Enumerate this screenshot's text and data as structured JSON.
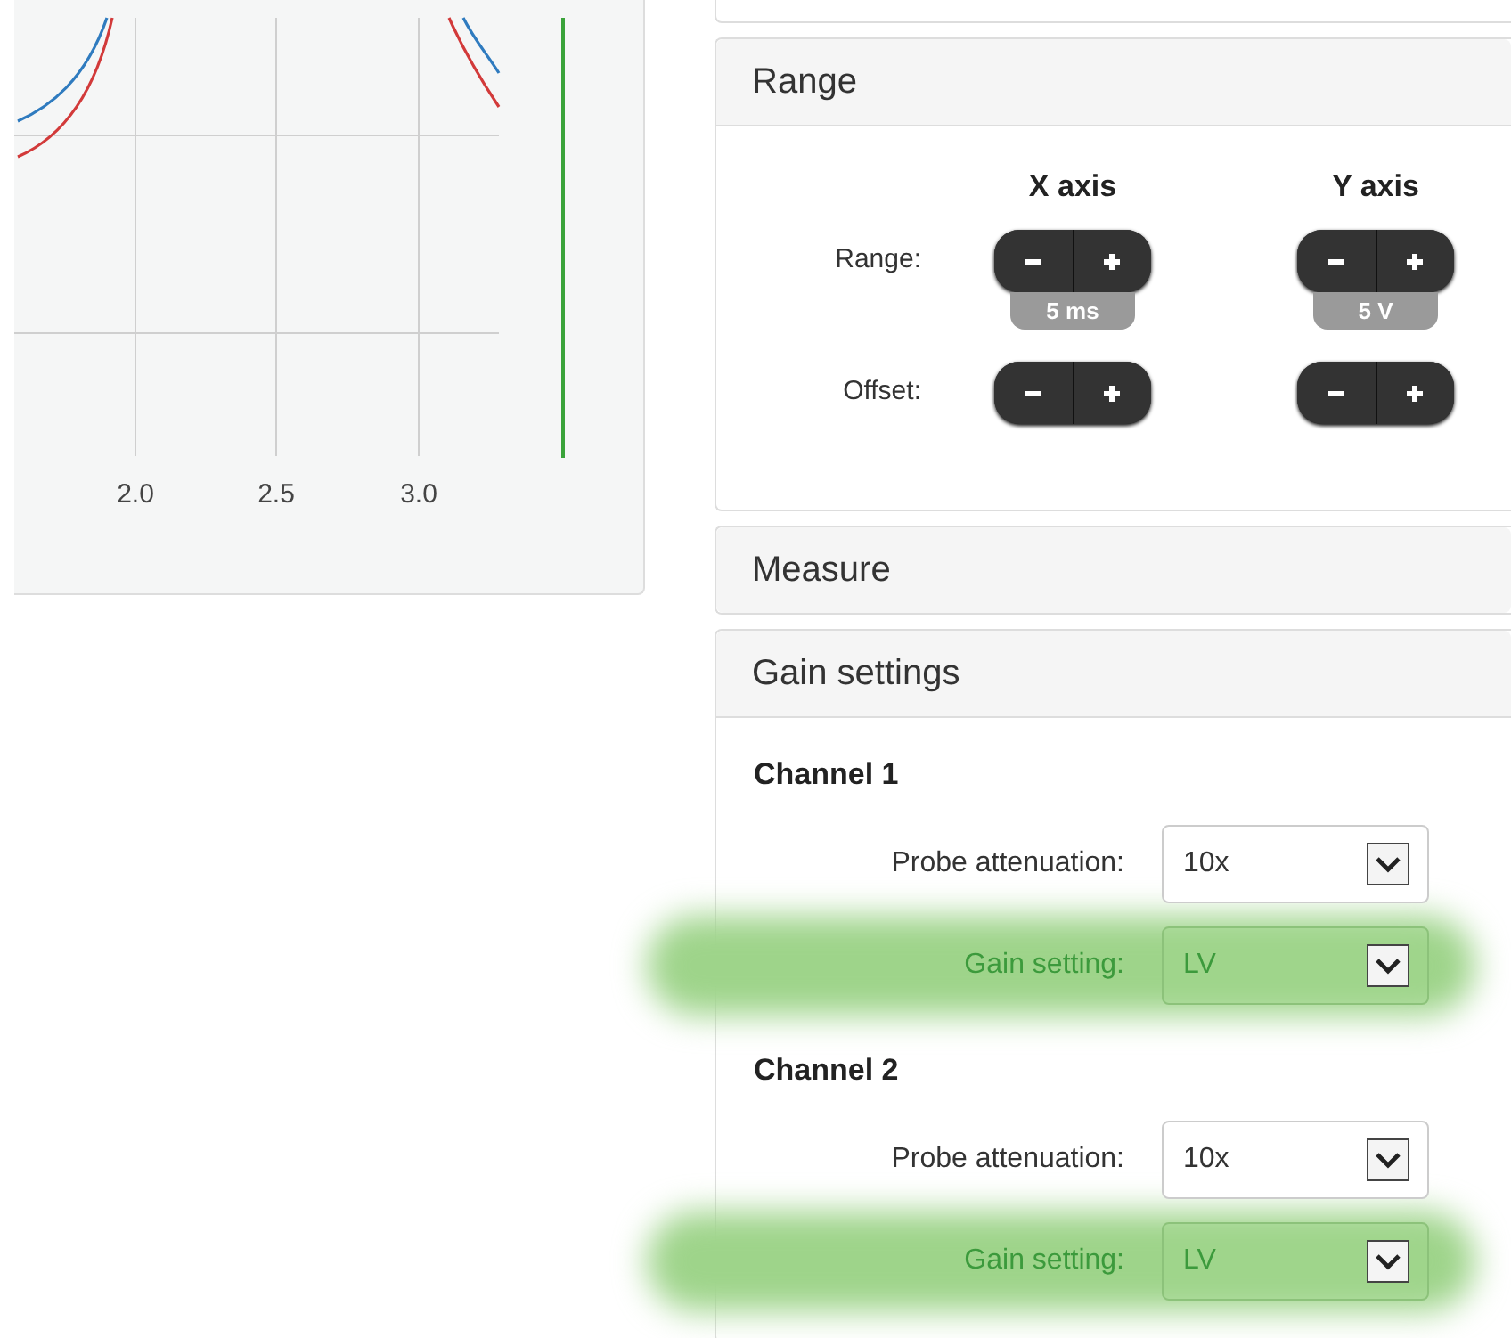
{
  "plot": {
    "x_tick_labels": [
      "2.0",
      "2.5",
      "3.0"
    ]
  },
  "panels": [
    {
      "kind": "range",
      "title": "Range",
      "expanded": true,
      "axes": [
        "X axis",
        "Y axis"
      ],
      "rows": [
        {
          "label": "Range:",
          "controls": [
            {
              "kind": "stepper",
              "readout": "5 ms"
            },
            {
              "kind": "stepper",
              "readout": "5 V"
            }
          ]
        },
        {
          "label": "Offset:",
          "controls": [
            {
              "kind": "stepper"
            },
            {
              "kind": "stepper"
            }
          ]
        }
      ]
    },
    {
      "title": "Measure",
      "expanded": false
    },
    {
      "kind": "gain",
      "title": "Gain settings",
      "expanded": true,
      "channels": [
        {
          "title": "Channel 1",
          "settings": [
            {
              "label": "Probe attenuation:",
              "value": "10x",
              "highlighted": false
            },
            {
              "label": "Gain setting:",
              "value": "LV",
              "highlighted": true
            }
          ]
        },
        {
          "title": "Channel 2",
          "settings": [
            {
              "label": "Probe attenuation:",
              "value": "10x",
              "highlighted": false
            },
            {
              "label": "Gain setting:",
              "value": "LV",
              "highlighted": true
            }
          ]
        }
      ]
    }
  ]
}
